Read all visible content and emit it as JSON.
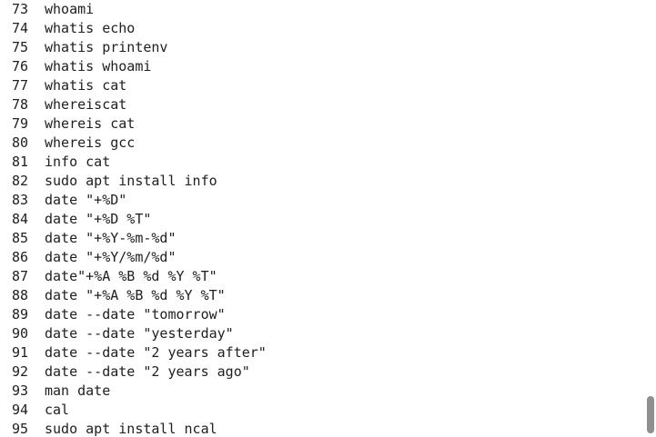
{
  "history": [
    {
      "num": "73",
      "cmd": "whoami"
    },
    {
      "num": "74",
      "cmd": "whatis echo"
    },
    {
      "num": "75",
      "cmd": "whatis printenv"
    },
    {
      "num": "76",
      "cmd": "whatis whoami"
    },
    {
      "num": "77",
      "cmd": "whatis cat"
    },
    {
      "num": "78",
      "cmd": "whereiscat"
    },
    {
      "num": "79",
      "cmd": "whereis cat"
    },
    {
      "num": "80",
      "cmd": "whereis gcc"
    },
    {
      "num": "81",
      "cmd": "info cat"
    },
    {
      "num": "82",
      "cmd": "sudo apt install info"
    },
    {
      "num": "83",
      "cmd": "date \"+%D\""
    },
    {
      "num": "84",
      "cmd": "date \"+%D %T\""
    },
    {
      "num": "85",
      "cmd": "date \"+%Y-%m-%d\""
    },
    {
      "num": "86",
      "cmd": "date \"+%Y/%m/%d\""
    },
    {
      "num": "87",
      "cmd": "date\"+%A %B %d %Y %T\""
    },
    {
      "num": "88",
      "cmd": "date \"+%A %B %d %Y %T\""
    },
    {
      "num": "89",
      "cmd": "date --date \"tomorrow\""
    },
    {
      "num": "90",
      "cmd": "date --date \"yesterday\""
    },
    {
      "num": "91",
      "cmd": "date --date \"2 years after\""
    },
    {
      "num": "92",
      "cmd": "date --date \"2 years ago\""
    },
    {
      "num": "93",
      "cmd": "man date"
    },
    {
      "num": "94",
      "cmd": "cal"
    },
    {
      "num": "95",
      "cmd": "sudo apt install ncal"
    }
  ]
}
